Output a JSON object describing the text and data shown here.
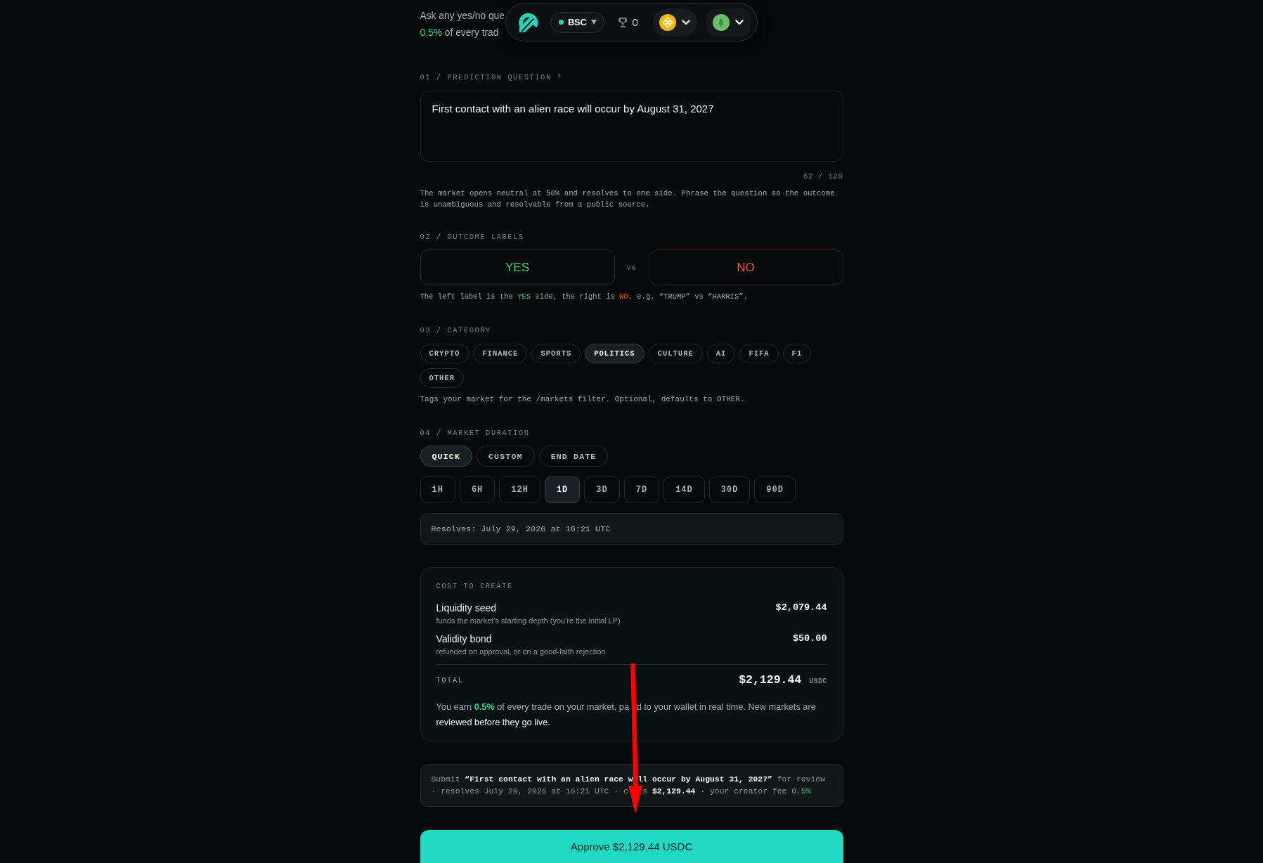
{
  "nav": {
    "network": "BSC",
    "trophy_count": "0"
  },
  "intro": {
    "lines": [
      [
        {
          "text": "Ask any yes/no que",
          "kind": "plain"
        }
      ],
      [
        {
          "text": "0.5%",
          "kind": "green"
        },
        {
          "text": " of every trad",
          "kind": "plain"
        }
      ]
    ]
  },
  "question": {
    "label": "01 / PREDICTION QUESTION *",
    "value": "First contact with an alien race will occur by August 31, 2027",
    "counter": "62 / 120",
    "hint": "The market opens neutral at 50% and resolves to one side. Phrase the question so the outcome is unambiguous and resolvable from a public source."
  },
  "outcomes": {
    "label": "02 / OUTCOME LABELS",
    "yes": "YES",
    "separator": "vs",
    "no": "NO",
    "hint": [
      {
        "text": "The left label is the ",
        "kind": "plain"
      },
      {
        "text": "YES",
        "kind": "green"
      },
      {
        "text": " side, the right is ",
        "kind": "plain"
      },
      {
        "text": "NO",
        "kind": "red"
      },
      {
        "text": ". e.g. “TRUMP” vs “HARRIS”.",
        "kind": "plain"
      }
    ]
  },
  "category": {
    "label": "03 / CATEGORY",
    "options": [
      {
        "label": "CRYPTO",
        "selected": false
      },
      {
        "label": "FINANCE",
        "selected": false
      },
      {
        "label": "SPORTS",
        "selected": false
      },
      {
        "label": "POLITICS",
        "selected": true
      },
      {
        "label": "CULTURE",
        "selected": false
      },
      {
        "label": "AI",
        "selected": false
      },
      {
        "label": "FIFA",
        "selected": false
      },
      {
        "label": "F1",
        "selected": false
      },
      {
        "label": "OTHER",
        "selected": false
      }
    ],
    "hint": "Tags your market for the /markets filter. Optional, defaults to OTHER."
  },
  "duration": {
    "label": "04 / MARKET DURATION",
    "modes": [
      {
        "label": "QUICK",
        "selected": true
      },
      {
        "label": "CUSTOM",
        "selected": false
      },
      {
        "label": "END DATE",
        "selected": false
      }
    ],
    "presets": [
      {
        "label": "1H",
        "selected": false
      },
      {
        "label": "6H",
        "selected": false
      },
      {
        "label": "12H",
        "selected": false
      },
      {
        "label": "1D",
        "selected": true
      },
      {
        "label": "3D",
        "selected": false
      },
      {
        "label": "7D",
        "selected": false
      },
      {
        "label": "14D",
        "selected": false
      },
      {
        "label": "30D",
        "selected": false
      },
      {
        "label": "90D",
        "selected": false
      }
    ],
    "resolves": "Resolves: July 29, 2026 at 16:21 UTC"
  },
  "cost": {
    "title": "COST TO CREATE",
    "items": [
      {
        "name": "Liquidity seed",
        "note": "funds the market's starting depth (you're the initial LP)",
        "amount": "$2,079.44"
      },
      {
        "name": "Validity bond",
        "note": "refunded on approval, or on a good-faith rejection",
        "amount": "$50.00"
      }
    ],
    "total": {
      "label": "TOTAL",
      "amount": "$2,129.44",
      "currency": "USDC"
    },
    "note": [
      {
        "text": "You earn ",
        "kind": "plain"
      },
      {
        "text": "0.5%",
        "kind": "green"
      },
      {
        "text": " of every trade on your market, pa   d to your wallet in real time. New markets are ",
        "kind": "plain"
      },
      {
        "text": "reviewed before they go live.",
        "kind": "bright"
      }
    ]
  },
  "summary": [
    {
      "text": "Submit ",
      "kind": "muted"
    },
    {
      "text": "“First contact with an alien race w ll occur by August 31, 2027”",
      "kind": "strong"
    },
    {
      "text": " for review · resolves July 29, 2026 at 16:21 UTC · c   s ",
      "kind": "muted"
    },
    {
      "text": "$2,129.44",
      "kind": "strong"
    },
    {
      "text": " · your creator fee ",
      "kind": "muted"
    },
    {
      "text": "0.5%",
      "kind": "green"
    }
  ],
  "approve_button": "Approve $2,129.44 USDC",
  "annotation": {
    "kind": "arrow"
  }
}
